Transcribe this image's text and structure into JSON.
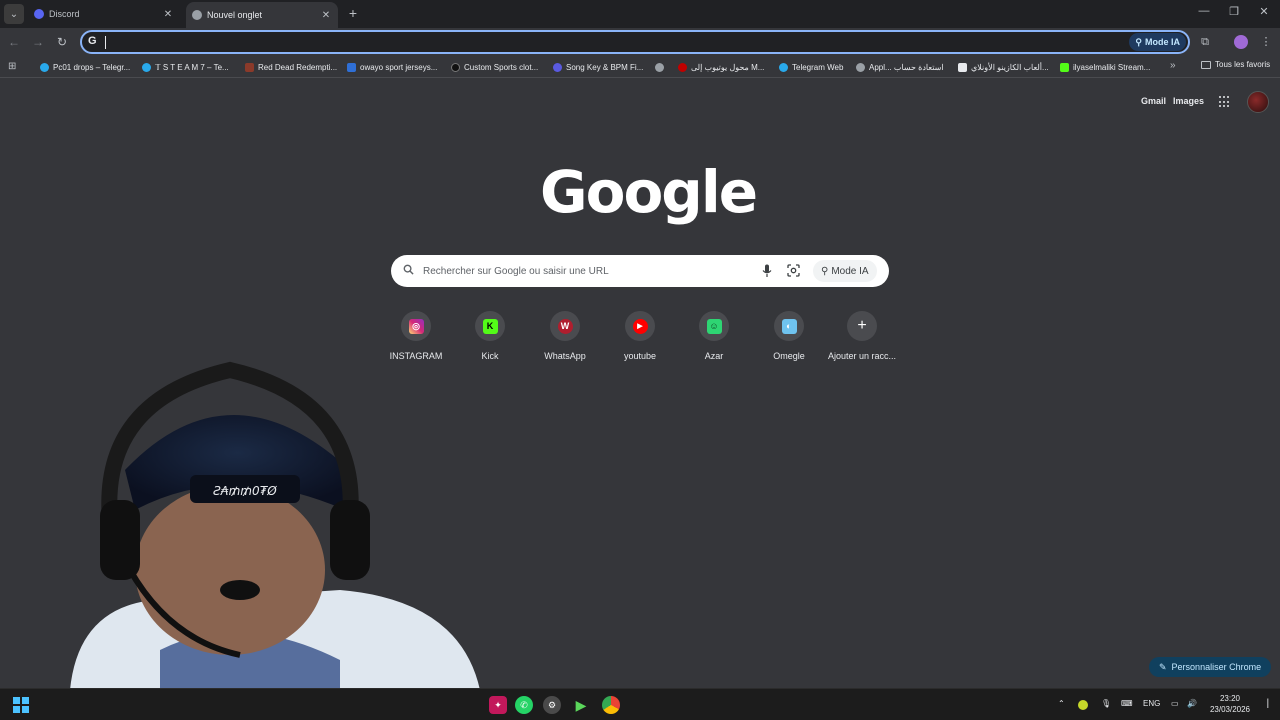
{
  "tabs": [
    {
      "title": "Discord",
      "favicon_color": "#5865f2",
      "active": false
    },
    {
      "title": "Nouvel onglet",
      "favicon_color": "#9aa0a6",
      "active": true
    }
  ],
  "window_controls": {
    "minimize": "—",
    "restore": "❐",
    "close": "✕"
  },
  "omnibox": {
    "value": "",
    "mode_label": "Mode IA"
  },
  "bookmarks": [
    {
      "label": "Pc01 drops – Telegr...",
      "color": "#29a9eb"
    },
    {
      "label": "𝕋 S T E A M 7 – Te...",
      "color": "#29a9eb"
    },
    {
      "label": "Red Dead Redempti...",
      "color": "#8b3a2a"
    },
    {
      "label": "owayo sport jerseys...",
      "color": "#2f6fd6"
    },
    {
      "label": "Custom Sports clot...",
      "color": "#111111"
    },
    {
      "label": "Song Key & BPM Fi...",
      "color": "#5a5ae0"
    },
    {
      "label": "",
      "color": "#9aa0a6"
    },
    {
      "label": "محول يوتيوب إلى M...",
      "color": "#c00000"
    },
    {
      "label": "Telegram Web",
      "color": "#29a9eb"
    },
    {
      "label": "Appl... استعادة حساب",
      "color": "#9aa0a6"
    },
    {
      "label": "ألعاب الكازينو الأونلاي...",
      "color": "#e8eaed"
    },
    {
      "label": "ilyaselmaliki Stream...",
      "color": "#53fc18"
    }
  ],
  "bookmarks_more": "»",
  "bookmarks_folder": "Tous les favoris",
  "header_links": {
    "gmail": "Gmail",
    "images": "Images"
  },
  "logo": "Google",
  "search": {
    "placeholder": "Rechercher sur Google ou saisir une URL",
    "mode_label": "Mode IA"
  },
  "shortcuts": [
    {
      "label": "INSTAGRAM",
      "icon": "instagram-icon",
      "bg": "#d6249f",
      "glyph": "◎"
    },
    {
      "label": "Kick",
      "icon": "kick-icon",
      "bg": "#53fc18",
      "glyph": "K"
    },
    {
      "label": "WhatsApp",
      "icon": "whatsapp-icon",
      "bg": "#b01e2e",
      "glyph": "W"
    },
    {
      "label": "youtube",
      "icon": "youtube-icon",
      "bg": "#ff0000",
      "glyph": "▶"
    },
    {
      "label": "Azar",
      "icon": "azar-icon",
      "bg": "#2ed573",
      "glyph": "☺"
    },
    {
      "label": "Omegle",
      "icon": "omegle-icon",
      "bg": "#6fc3ef",
      "glyph": "◐"
    },
    {
      "label": "Ajouter un racc...",
      "icon": "plus-icon",
      "bg": "transparent",
      "glyph": "+"
    }
  ],
  "customize_label": "Personnaliser Chrome",
  "taskbar": {
    "apps": [
      {
        "icon": "app-pink-icon",
        "color": "#c2185b"
      },
      {
        "icon": "whatsapp-taskbar-icon",
        "color": "#25d366"
      },
      {
        "icon": "steam-taskbar-icon",
        "color": "#4a4a4a"
      },
      {
        "icon": "media-player-taskbar-icon",
        "color": "#2e7d32"
      },
      {
        "icon": "chrome-taskbar-icon",
        "color": "#4285f4"
      }
    ],
    "language": "ENG",
    "time": "23:20",
    "date": "23/03/2026"
  }
}
